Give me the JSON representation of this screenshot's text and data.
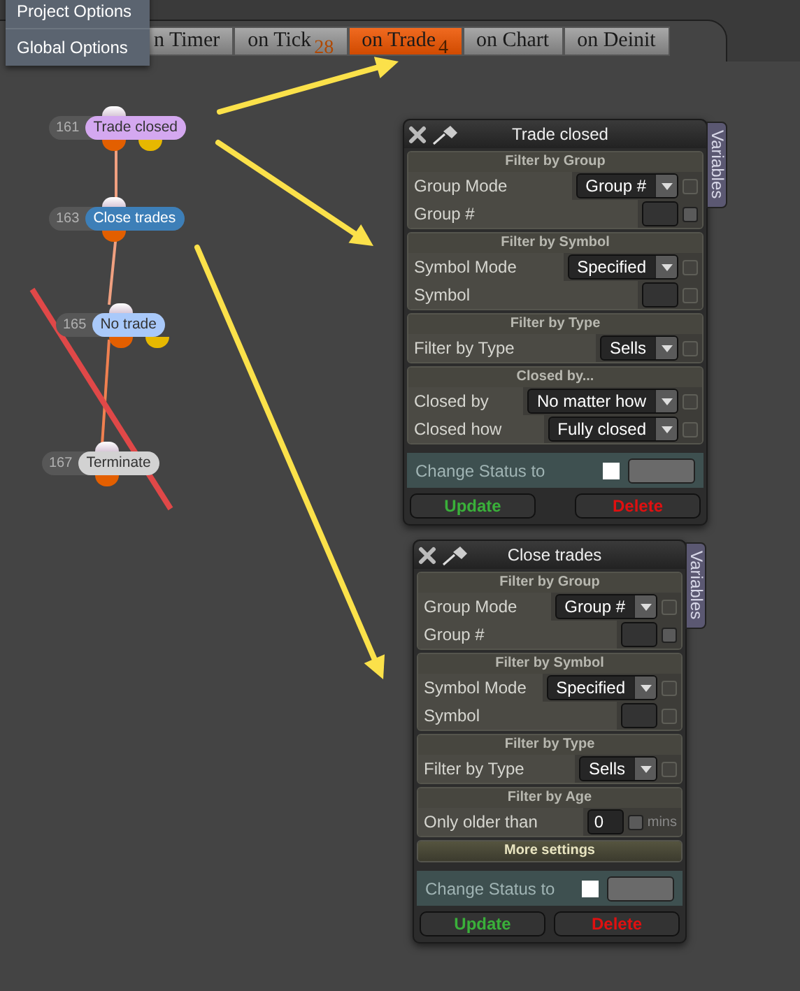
{
  "menu": [
    {
      "label": "Project Options"
    },
    {
      "label": "Global Options"
    }
  ],
  "tabs": [
    {
      "label": "n Timer",
      "selected": false
    },
    {
      "label": "on Tick",
      "badge": "28",
      "selected": false
    },
    {
      "label": "on Trade",
      "badge": "4",
      "selected": true
    },
    {
      "label": "on Chart",
      "selected": false
    },
    {
      "label": "on Deinit",
      "selected": false
    }
  ],
  "nodes": [
    {
      "id": "161",
      "label": "Trade closed",
      "color": "#d4a8f0",
      "extra_output": true
    },
    {
      "id": "163",
      "label": "Close trades",
      "color": "#3d7fb8",
      "extra_output": false
    },
    {
      "id": "165",
      "label": "No trade",
      "color": "#a9c9fa",
      "extra_output": true
    },
    {
      "id": "167",
      "label": "Terminate",
      "color": "#d2d2d2",
      "extra_output": false
    }
  ],
  "panels": [
    {
      "title": "Trade closed",
      "side_tab": "Variables",
      "sections": [
        {
          "heading": "Filter by Group",
          "expanded": true,
          "rows": [
            {
              "kind": "select",
              "label": "Group Mode",
              "value": "Group #",
              "checkbox_enabled": false
            },
            {
              "kind": "input",
              "label": "Group #",
              "checkbox_enabled": true
            }
          ]
        },
        {
          "heading": "Filter by Symbol",
          "expanded": true,
          "rows": [
            {
              "kind": "select",
              "label": "Symbol Mode",
              "value": "Specified",
              "checkbox_enabled": false
            },
            {
              "kind": "input",
              "label": "Symbol",
              "checkbox_enabled": false
            }
          ]
        },
        {
          "heading": "Filter by Type",
          "expanded": true,
          "rows": [
            {
              "kind": "select",
              "label": "Filter by Type",
              "value": "Sells",
              "checkbox_enabled": false
            }
          ]
        },
        {
          "heading": "Closed by...",
          "expanded": true,
          "rows": [
            {
              "kind": "select",
              "label": "Closed by",
              "value": "No matter how",
              "checkbox_enabled": false
            },
            {
              "kind": "select",
              "label": "Closed how",
              "value": "Fully closed",
              "checkbox_enabled": false
            }
          ]
        }
      ],
      "status": {
        "label": "Change Status to",
        "checked": false
      },
      "buttons": [
        {
          "label": "Update",
          "kind": "update"
        },
        {
          "label": "Delete",
          "kind": "delete"
        }
      ]
    },
    {
      "title": "Close trades",
      "side_tab": "Variables",
      "sections": [
        {
          "heading": "Filter by Group",
          "expanded": true,
          "rows": [
            {
              "kind": "select",
              "label": "Group Mode",
              "value": "Group #",
              "checkbox_enabled": false
            },
            {
              "kind": "input",
              "label": "Group #",
              "checkbox_enabled": true
            }
          ]
        },
        {
          "heading": "Filter by Symbol",
          "expanded": true,
          "rows": [
            {
              "kind": "select",
              "label": "Symbol Mode",
              "value": "Specified",
              "checkbox_enabled": false
            },
            {
              "kind": "input",
              "label": "Symbol",
              "checkbox_enabled": false
            }
          ]
        },
        {
          "heading": "Filter by Type",
          "expanded": true,
          "rows": [
            {
              "kind": "select",
              "label": "Filter by Type",
              "value": "Sells",
              "checkbox_enabled": false
            }
          ]
        },
        {
          "heading": "Filter by Age",
          "expanded": true,
          "rows": [
            {
              "kind": "number",
              "label": "Only older than",
              "value": "0",
              "unit": "mins",
              "checkbox_enabled": true
            }
          ]
        },
        {
          "heading": "More settings",
          "expanded": false
        }
      ],
      "status": {
        "label": "Change Status to",
        "checked": false
      },
      "buttons": [
        {
          "label": "Update",
          "kind": "update"
        },
        {
          "label": "Delete",
          "kind": "delete"
        }
      ]
    }
  ]
}
